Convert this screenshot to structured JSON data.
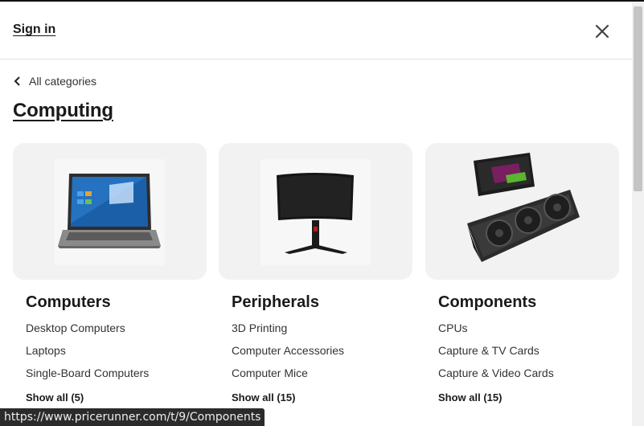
{
  "header": {
    "sign_in": "Sign in"
  },
  "breadcrumb": {
    "back_label": "All categories"
  },
  "page": {
    "title": "Computing"
  },
  "cards": [
    {
      "title": "Computers",
      "links": [
        "Desktop Computers",
        "Laptops",
        "Single-Board Computers"
      ],
      "show_all": "Show all (5)",
      "image": "laptop-image"
    },
    {
      "title": "Peripherals",
      "links": [
        "3D Printing",
        "Computer Accessories",
        "Computer Mice"
      ],
      "show_all": "Show all (15)",
      "image": "monitor-image"
    },
    {
      "title": "Components",
      "links": [
        "CPUs",
        "Capture & TV Cards",
        "Capture & Video Cards"
      ],
      "show_all": "Show all (15)",
      "image": "graphics-card-image"
    }
  ],
  "status_bar": {
    "url": "https://www.pricerunner.com/t/9/Components"
  }
}
